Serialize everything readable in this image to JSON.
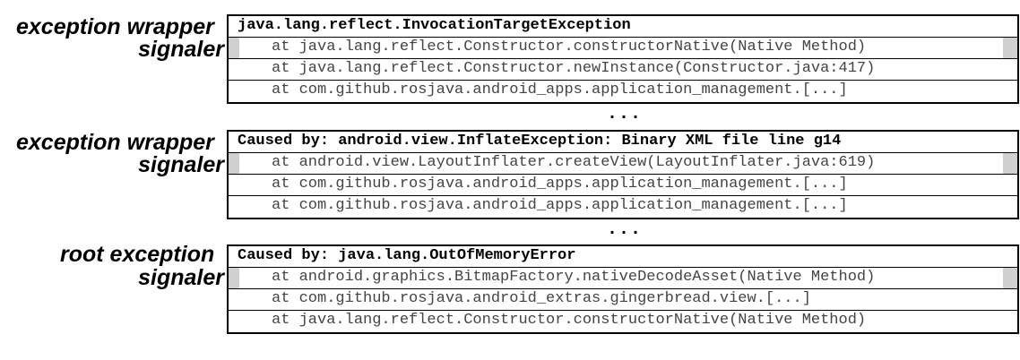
{
  "groups": [
    {
      "label_top": "exception wrapper",
      "label_bottom": "signaler",
      "header": "java.lang.reflect.InvocationTargetException",
      "frames": [
        "at java.lang.reflect.Constructor.constructorNative(Native Method)",
        "at java.lang.reflect.Constructor.newInstance(Constructor.java:417)",
        "at com.github.rosjava.android_apps.application_management.[...]"
      ]
    },
    {
      "label_top": "exception wrapper",
      "label_bottom": "signaler",
      "header": "Caused by: android.view.InflateException: Binary XML file line g14",
      "frames": [
        "at android.view.LayoutInflater.createView(LayoutInflater.java:619)",
        "at com.github.rosjava.android_apps.application_management.[...]",
        "at com.github.rosjava.android_apps.application_management.[...]"
      ]
    },
    {
      "label_top": "root exception",
      "label_bottom": "signaler",
      "header": "Caused by: java.lang.OutOfMemoryError",
      "frames": [
        "at android.graphics.BitmapFactory.nativeDecodeAsset(Native Method)",
        "at com.github.rosjava.android_extras.gingerbread.view.[...]",
        "at java.lang.reflect.Constructor.constructorNative(Native Method)"
      ]
    }
  ],
  "ellipsis": "..."
}
